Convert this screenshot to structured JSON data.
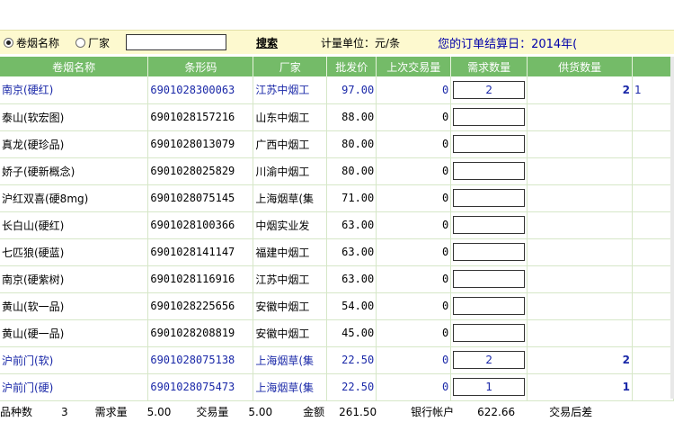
{
  "toolbar": {
    "radio_name_label": "卷烟名称",
    "radio_maker_label": "厂家",
    "search_value": "",
    "search_label": "搜索",
    "unit_label": "计量单位：元/条",
    "settle_label": "您的订单结算日：2014年("
  },
  "columns": [
    "卷烟名称",
    "条形码",
    "厂家",
    "批发价",
    "上次交易量",
    "需求数量",
    "供货数量",
    ""
  ],
  "rows": [
    {
      "name": "南京(硬红)",
      "code": "6901028300063",
      "maker": "江苏中烟工",
      "price": "97.00",
      "last": "0",
      "demand": "2",
      "supply": "2",
      "extra": "1",
      "highlight": true
    },
    {
      "name": "泰山(软宏图)",
      "code": "6901028157216",
      "maker": "山东中烟工",
      "price": "88.00",
      "last": "0",
      "demand": "",
      "supply": "",
      "extra": "",
      "highlight": false
    },
    {
      "name": "真龙(硬珍品)",
      "code": "6901028013079",
      "maker": "广西中烟工",
      "price": "80.00",
      "last": "0",
      "demand": "",
      "supply": "",
      "extra": "",
      "highlight": false
    },
    {
      "name": "娇子(硬新概念)",
      "code": "6901028025829",
      "maker": "川渝中烟工",
      "price": "80.00",
      "last": "0",
      "demand": "",
      "supply": "",
      "extra": "",
      "highlight": false
    },
    {
      "name": "沪红双喜(硬8mg)",
      "code": "6901028075145",
      "maker": "上海烟草(集",
      "price": "71.00",
      "last": "0",
      "demand": "",
      "supply": "",
      "extra": "",
      "highlight": false
    },
    {
      "name": "长白山(硬红)",
      "code": "6901028100366",
      "maker": "中烟实业发",
      "price": "63.00",
      "last": "0",
      "demand": "",
      "supply": "",
      "extra": "",
      "highlight": false
    },
    {
      "name": "七匹狼(硬蓝)",
      "code": "6901028141147",
      "maker": "福建中烟工",
      "price": "63.00",
      "last": "0",
      "demand": "",
      "supply": "",
      "extra": "",
      "highlight": false
    },
    {
      "name": "南京(硬紫树)",
      "code": "6901028116916",
      "maker": "江苏中烟工",
      "price": "63.00",
      "last": "0",
      "demand": "",
      "supply": "",
      "extra": "",
      "highlight": false
    },
    {
      "name": "黄山(软一品)",
      "code": "6901028225656",
      "maker": "安徽中烟工",
      "price": "54.00",
      "last": "0",
      "demand": "",
      "supply": "",
      "extra": "",
      "highlight": false
    },
    {
      "name": "黄山(硬一品)",
      "code": "6901028208819",
      "maker": "安徽中烟工",
      "price": "45.00",
      "last": "0",
      "demand": "",
      "supply": "",
      "extra": "",
      "highlight": false
    },
    {
      "name": "沪前门(软)",
      "code": "6901028075138",
      "maker": "上海烟草(集",
      "price": "22.50",
      "last": "0",
      "demand": "2",
      "supply": "2",
      "extra": "",
      "highlight": true
    },
    {
      "name": "沪前门(硬)",
      "code": "6901028075473",
      "maker": "上海烟草(集",
      "price": "22.50",
      "last": "0",
      "demand": "1",
      "supply": "1",
      "extra": "",
      "highlight": true
    }
  ],
  "footer": {
    "kinds_label": "品种数",
    "kinds_value": "3",
    "demand_label": "需求量",
    "demand_value": "5.00",
    "trade_label": "交易量",
    "trade_value": "5.00",
    "amount_label": "金额",
    "amount_value": "261.50",
    "bank_label": "银行帐户",
    "bank_value": "622.66",
    "after_label": "交易后差"
  },
  "colors": {
    "header_green": "#74bb68",
    "toolbar_yellow": "#fdf9cf",
    "highlight_blue": "#1a28a8"
  }
}
